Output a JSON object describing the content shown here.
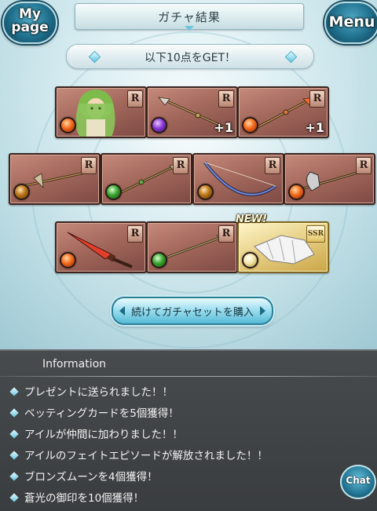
{
  "header": {
    "title": "ガチャ結果",
    "mypage_label_top": "My",
    "mypage_label_bottom": "page",
    "menu_label": "Menu"
  },
  "banner": {
    "text": "以下10点をGET！"
  },
  "cards": [
    {
      "rarity": "R",
      "element": "fire",
      "art": "character-portrait",
      "plus": ""
    },
    {
      "rarity": "R",
      "element": "dark",
      "art": "spear",
      "plus": "+1"
    },
    {
      "rarity": "R",
      "element": "fire",
      "art": "spear",
      "plus": "+1"
    },
    {
      "rarity": "R",
      "element": "earth",
      "art": "spear",
      "plus": ""
    },
    {
      "rarity": "R",
      "element": "wind",
      "art": "spear",
      "plus": ""
    },
    {
      "rarity": "R",
      "element": "earth",
      "art": "bow",
      "plus": ""
    },
    {
      "rarity": "R",
      "element": "fire",
      "art": "axe",
      "plus": ""
    },
    {
      "rarity": "R",
      "element": "fire",
      "art": "dagger",
      "plus": ""
    },
    {
      "rarity": "R",
      "element": "wind",
      "art": "spear",
      "plus": ""
    },
    {
      "rarity": "SSR",
      "element": "light",
      "art": "gauntlet",
      "plus": "",
      "new_label": "NEW!"
    }
  ],
  "buy_button": {
    "label": "続けてガチャセットを購入"
  },
  "information": {
    "title": "Information",
    "items": [
      "プレゼントに送られました！！",
      "ベッティングカードを5個獲得！",
      "アイルが仲間に加わりました！！",
      "アイルのフェイトエピソードが解放されました！！",
      "ブロンズムーンを4個獲得！",
      "蒼光の御印を10個獲得！"
    ]
  },
  "chat": {
    "label": "Chat"
  },
  "colors": {
    "panel_bg": "#3f4345",
    "card_r": "#a1665a",
    "card_ssr": "#e8d28a",
    "accent": "#56bbd7"
  }
}
